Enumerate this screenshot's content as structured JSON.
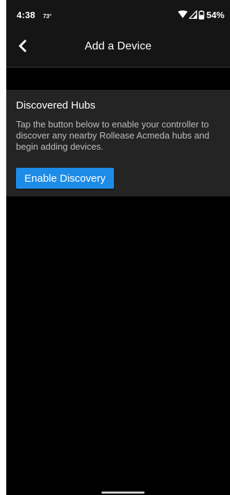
{
  "status_bar": {
    "time": "4:38",
    "temperature": "73°",
    "battery": "54%",
    "icons": [
      "wifi-icon",
      "signal-icon",
      "battery-icon"
    ]
  },
  "header": {
    "title": "Add a Device",
    "back_icon": "chevron-left-icon"
  },
  "discovered_hubs": {
    "title": "Discovered Hubs",
    "description": "Tap the button below to enable your controller to discover any nearby Rollease Acmeda hubs and begin adding devices.",
    "button_label": "Enable Discovery"
  },
  "colors": {
    "background": "#000000",
    "header_bg": "#151515",
    "card_bg": "#242424",
    "accent": "#1d8ce8",
    "text_primary": "#ffffff",
    "text_secondary": "#bdbdbd"
  }
}
